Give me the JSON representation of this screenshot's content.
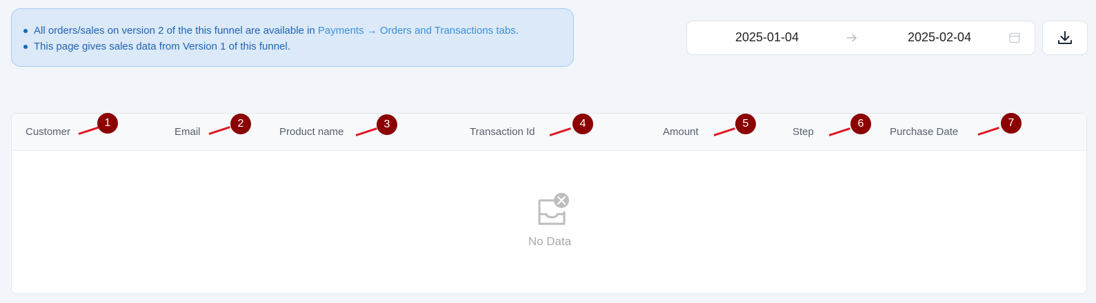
{
  "banner": {
    "line1_prefix": "All orders/sales on version 2 of the this funnel are available in ",
    "line1_link": "Payments → Orders and Transactions tabs",
    "line1_suffix": ".",
    "line2": "This page gives sales data from Version 1 of this funnel."
  },
  "date_range": {
    "start": "2025-01-04",
    "end": "2025-02-04",
    "separator_icon": "arrow-right-icon",
    "calendar_icon": "calendar-icon"
  },
  "download": {
    "icon": "download-icon"
  },
  "table": {
    "columns": [
      "Customer",
      "Email",
      "Product name",
      "Transaction Id",
      "Amount",
      "Step",
      "Purchase Date"
    ],
    "empty_text": "No Data"
  },
  "markers": [
    "1",
    "2",
    "3",
    "4",
    "5",
    "6",
    "7"
  ],
  "colors": {
    "banner_bg": "#dbe9f8",
    "banner_text": "#1f63b3",
    "link": "#3d8fd8",
    "marker": "#8b0000",
    "marker_line": "#e0141e"
  }
}
